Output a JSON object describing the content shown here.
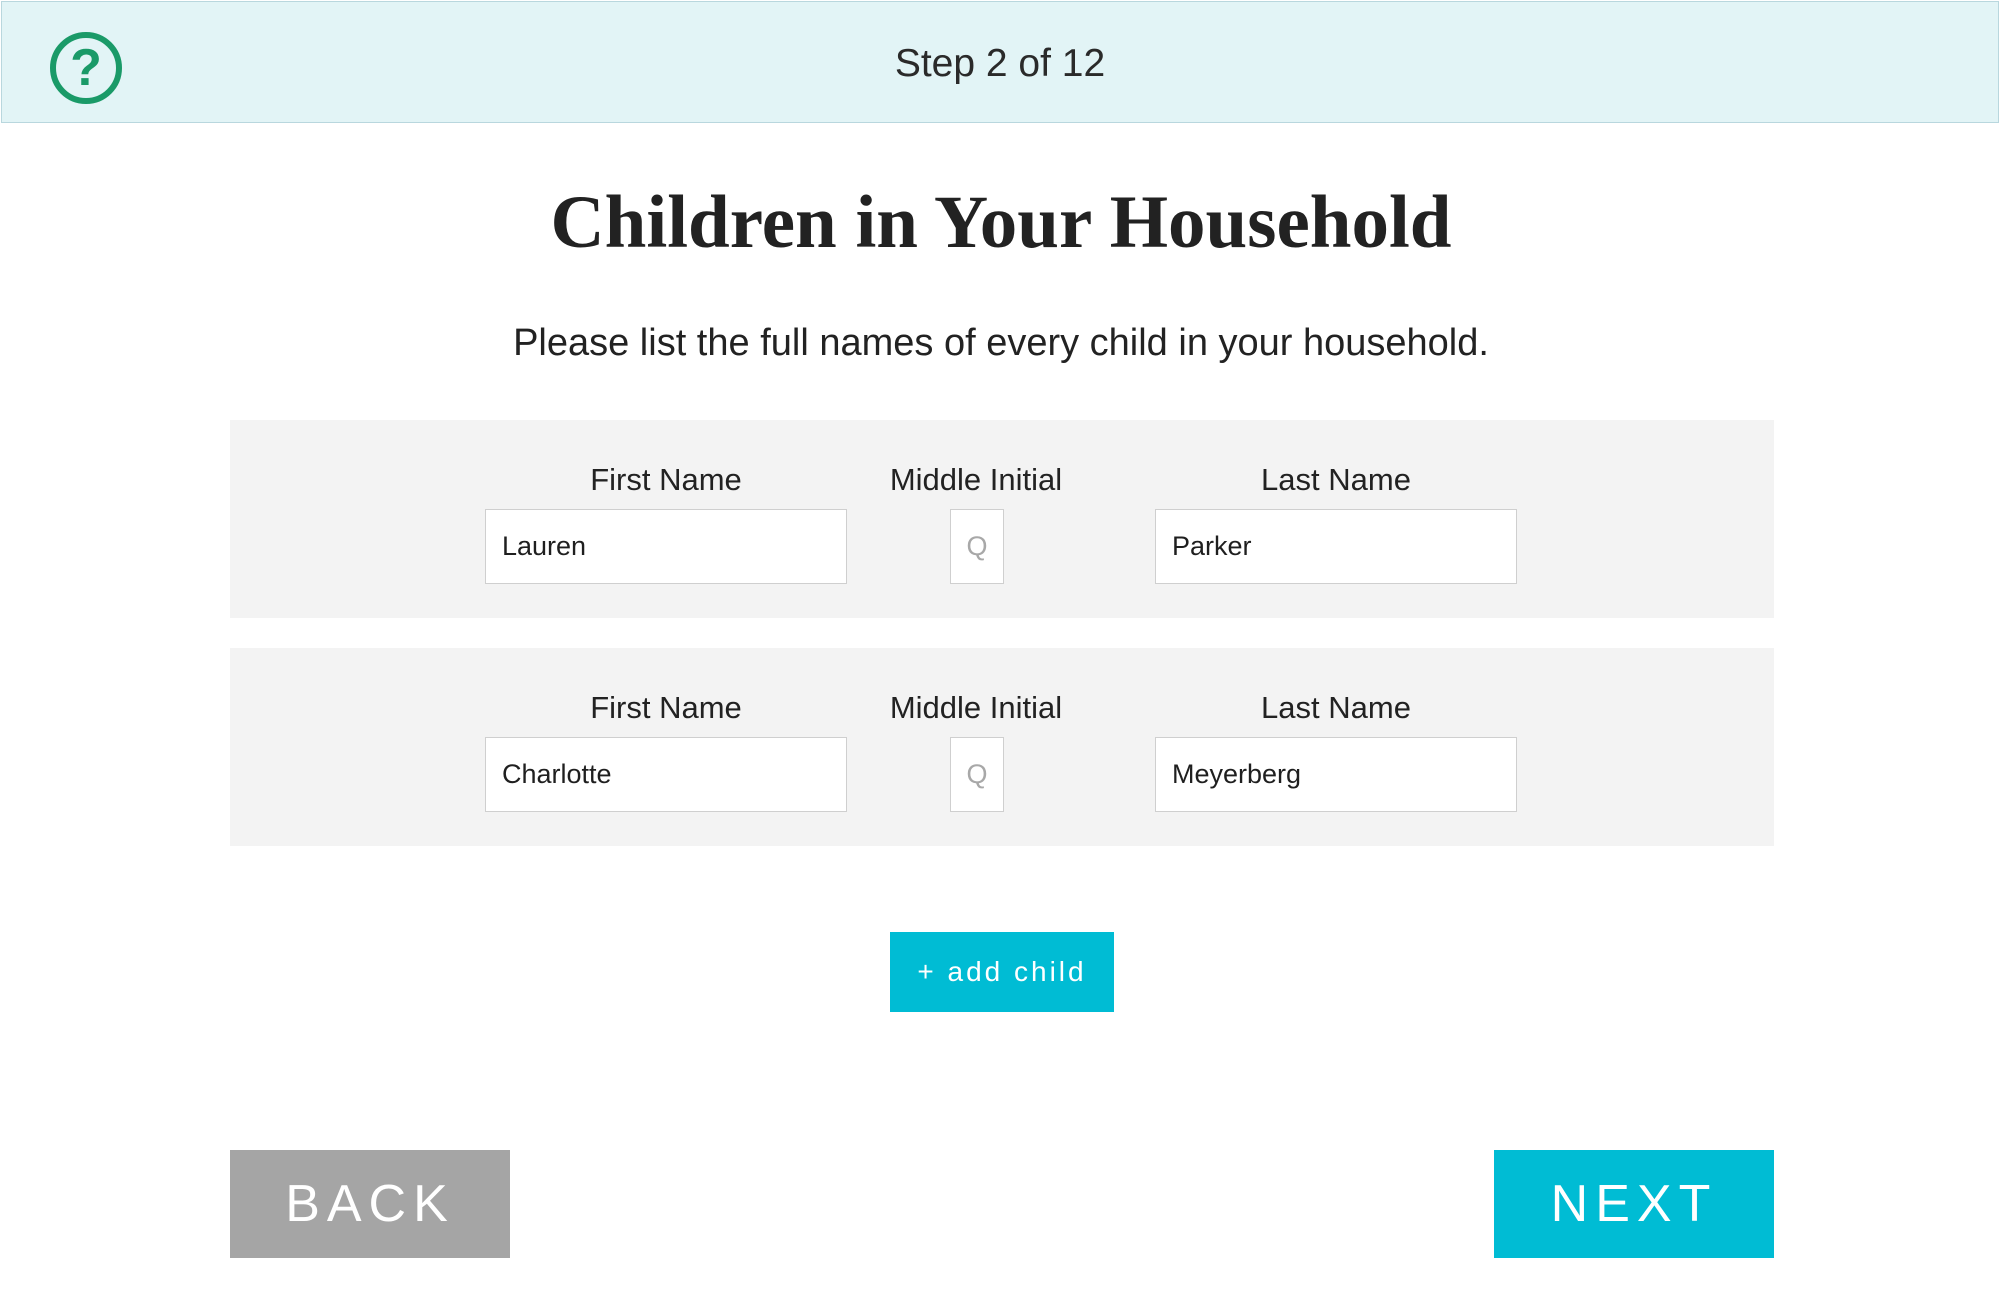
{
  "header": {
    "help_icon_glyph": "?",
    "step_text": "Step 2 of 12",
    "help_icon_color": "#1a9a68",
    "background": "#e2f4f6"
  },
  "page": {
    "title": "Children in Your Household",
    "subtitle": "Please list the full names of every child in your household."
  },
  "children": [
    {
      "first_name_label": "First Name",
      "first_name_value": "Lauren",
      "middle_initial_label": "Middle Initial",
      "middle_initial_value": "",
      "middle_initial_placeholder": "Q",
      "last_name_label": "Last Name",
      "last_name_value": "Parker"
    },
    {
      "first_name_label": "First Name",
      "first_name_value": "Charlotte",
      "middle_initial_label": "Middle Initial",
      "middle_initial_value": "",
      "middle_initial_placeholder": "Q",
      "last_name_label": "Last Name",
      "last_name_value": "Meyerberg"
    }
  ],
  "actions": {
    "add_child_label": "+ add child",
    "back_label": "BACK",
    "next_label": "NEXT",
    "accent_color": "#00bcd4",
    "back_color": "#a5a5a5"
  }
}
